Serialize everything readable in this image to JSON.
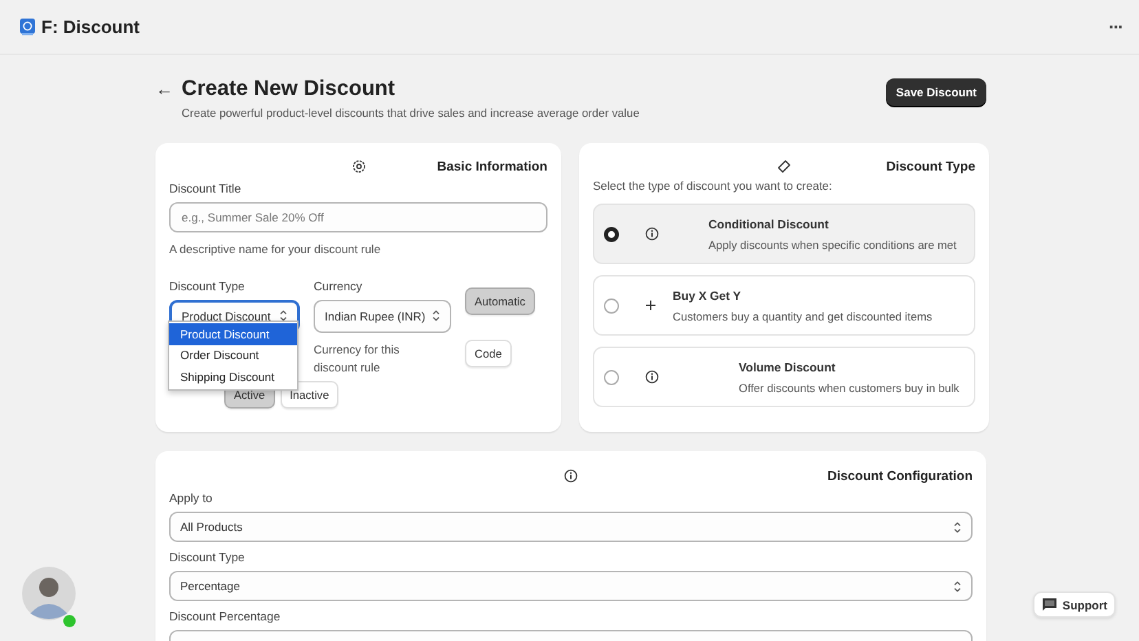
{
  "app_bar": {
    "title": "F: Discount",
    "menu": "···"
  },
  "header": {
    "back": "←",
    "title": "Create New Discount",
    "subtitle": "Create powerful product-level discounts that drive sales and increase average order value",
    "save_button": "Save Discount"
  },
  "basic_information": {
    "title": "Basic Information",
    "discount_title": {
      "label": "Discount Title",
      "placeholder": "e.g., Summer Sale 20% Off",
      "help": "A descriptive name for your discount rule"
    },
    "discount_type": {
      "label": "Discount Type",
      "value": "Product Discount",
      "expanded": true,
      "options": [
        {
          "label": "Product Discount",
          "selected": true
        },
        {
          "label": "Order Discount",
          "selected": false
        },
        {
          "label": "Shipping Discount",
          "selected": false
        }
      ]
    },
    "currency": {
      "label": "Currency",
      "value": "Indian Rupee (INR)",
      "help": "Currency for this discount rule"
    },
    "method": [
      {
        "label": "Automatic",
        "selected": true
      },
      {
        "label": "Code",
        "selected": false
      }
    ],
    "status": [
      {
        "label": "Active",
        "selected": true
      },
      {
        "label": "Inactive",
        "selected": false
      }
    ]
  },
  "discount_type_card": {
    "title": "Discount Type",
    "prompt": "Select the type of discount you want to create:",
    "options": [
      {
        "title": "Conditional Discount",
        "description": "Apply discounts when specific conditions are met",
        "selected": true
      },
      {
        "title": "Buy X Get Y",
        "description": "Customers buy a quantity and get discounted items",
        "selected": false
      },
      {
        "title": "Volume Discount",
        "description": "Offer discounts when customers buy in bulk",
        "selected": false
      }
    ]
  },
  "configuration": {
    "title": "Discount Configuration",
    "fields": [
      {
        "kind": "select",
        "label": "Apply to",
        "value": "All Products"
      },
      {
        "kind": "select",
        "label": "Discount Type",
        "value": "Percentage"
      },
      {
        "kind": "input",
        "label": "Discount Percentage"
      }
    ]
  },
  "support_button": "Support"
}
